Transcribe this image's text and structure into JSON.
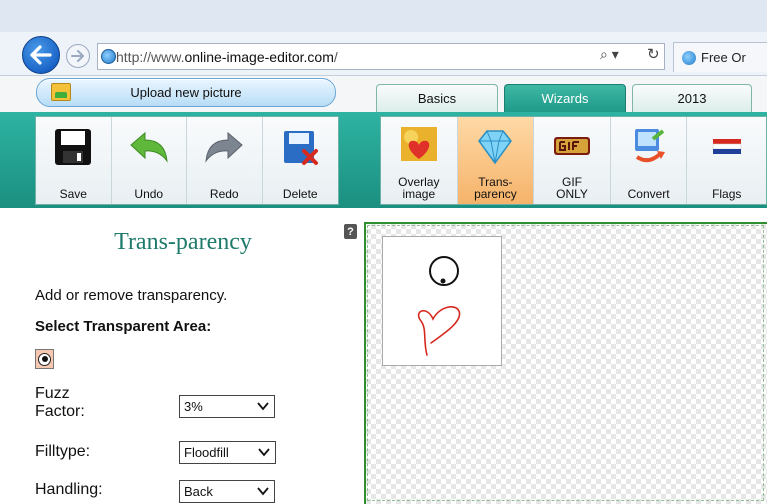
{
  "browser": {
    "address_prefix": "http://www.",
    "address_host": "online-image-editor.com",
    "address_suffix": "/",
    "search_glyph": "⌕ ▾",
    "refresh_glyph": "↻",
    "tab_title": "Free Or"
  },
  "upload": {
    "label": "Upload new picture"
  },
  "category_tabs": [
    {
      "label": "Basics",
      "active": false
    },
    {
      "label": "Wizards",
      "active": true
    },
    {
      "label": "2013",
      "active": false
    }
  ],
  "basic_tools": [
    {
      "label": "Save",
      "icon": "save-icon"
    },
    {
      "label": "Undo",
      "icon": "undo-icon"
    },
    {
      "label": "Redo",
      "icon": "redo-icon"
    },
    {
      "label": "Delete",
      "icon": "delete-icon"
    }
  ],
  "wizard_tools": [
    {
      "label_line1": "Overlay",
      "label_line2": "image",
      "icon": "overlay-image-icon",
      "selected": false
    },
    {
      "label_line1": "Trans-",
      "label_line2": "parency",
      "icon": "diamond-icon",
      "selected": true
    },
    {
      "label_line1": "GIF",
      "label_line2": "ONLY",
      "icon": "gif-icon",
      "selected": false
    },
    {
      "label_line1": "",
      "label_line2": "Convert",
      "icon": "convert-icon",
      "selected": false
    },
    {
      "label_line1": "",
      "label_line2": "Flags",
      "icon": "flag-icon",
      "selected": false
    }
  ],
  "panel": {
    "help": "?",
    "title": "Trans-parency",
    "description": "Add or remove transparency.",
    "subheading": "Select Transparent Area:",
    "fuzz_label_1": "Fuzz",
    "fuzz_label_2": "Factor:",
    "fuzz_value": "3%",
    "filltype_label": "Filltype:",
    "filltype_value": "Floodfill",
    "handling_label": "Handling:",
    "handling_value": "Back"
  },
  "colors": {
    "accent_teal": "#1f9a88",
    "title_green": "#1e7a6a",
    "selected_tool": "#f5b36a",
    "canvas_border": "#2f8f2f"
  }
}
